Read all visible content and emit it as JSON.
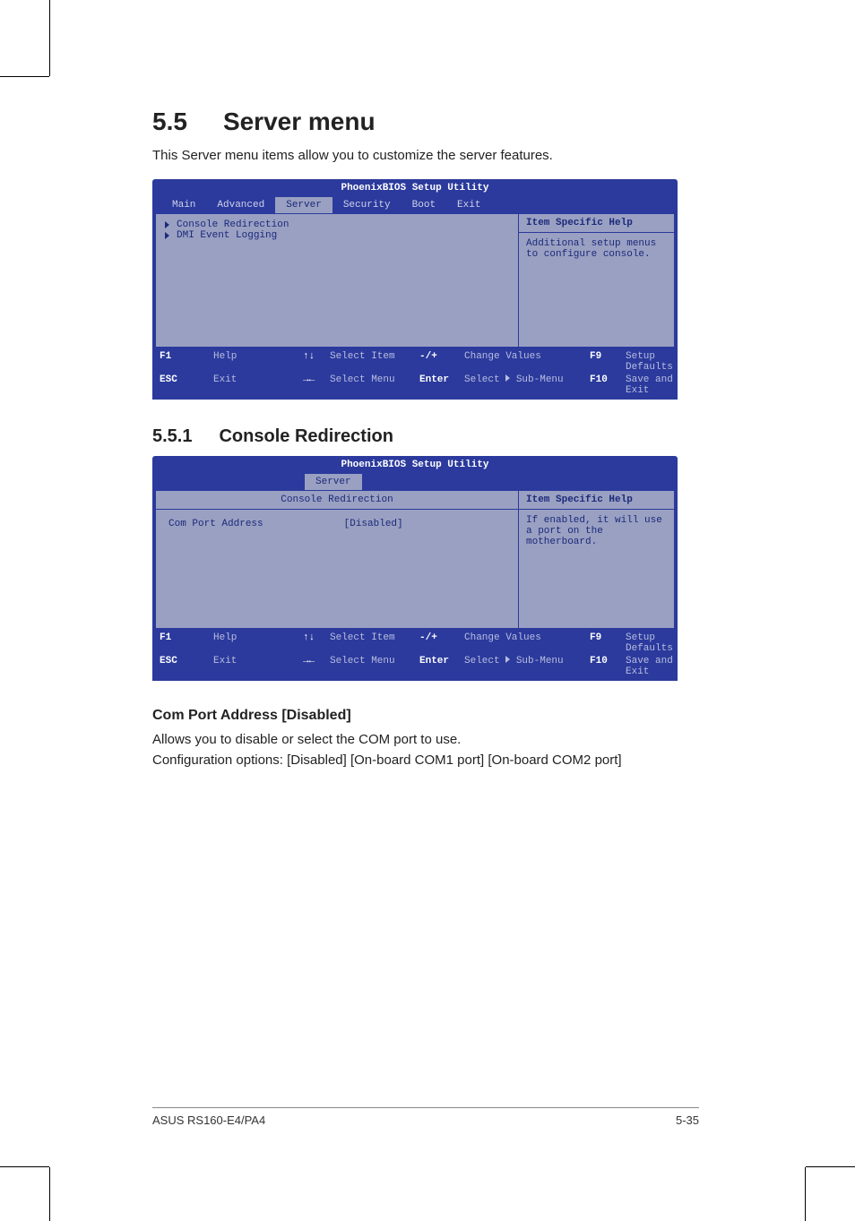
{
  "section": {
    "num": "5.5",
    "title": "Server menu"
  },
  "intro": "This Server menu items allow you to customize the server features.",
  "subsection": {
    "num": "5.5.1",
    "title": "Console Redirection"
  },
  "option_heading": "Com Port Address [Disabled]",
  "option_desc_l1": "Allows you to disable or select the COM port to use.",
  "option_desc_l2": "Configuration options: [Disabled] [On-board COM1 port] [On-board COM2 port]",
  "footer": {
    "left": "ASUS RS160-E4/PA4",
    "right": "5-35"
  },
  "bios1": {
    "title": "PhoenixBIOS Setup Utility",
    "tabs": {
      "main": "Main",
      "advanced": "Advanced",
      "server": "Server",
      "security": "Security",
      "boot": "Boot",
      "exit": "Exit"
    },
    "menu": {
      "item1": "Console Redirection",
      "item2": "DMI Event Logging"
    },
    "help_head": "Item Specific Help",
    "help_body": "Additional setup menus to configure console.",
    "keys": {
      "f1": "F1",
      "help": "Help",
      "updown": "↑↓",
      "select_item": "Select Item",
      "pm": "-/+",
      "change": "Change Values",
      "f9": "F9",
      "defaults": "Setup Defaults",
      "esc": "ESC",
      "exit": "Exit",
      "lr": "→←",
      "select_menu": "Select Menu",
      "enter": "Enter",
      "submenu_pre": "Select ",
      "submenu_post": " Sub-Menu",
      "f10": "F10",
      "save": "Save and Exit"
    }
  },
  "bios2": {
    "title": "PhoenixBIOS Setup Utility",
    "tab": "Server",
    "section": "Console Redirection",
    "field_label": "Com Port Address",
    "field_value": "[Disabled]",
    "help_head": "Item Specific Help",
    "help_body": "If enabled, it will use a port on the motherboard."
  }
}
